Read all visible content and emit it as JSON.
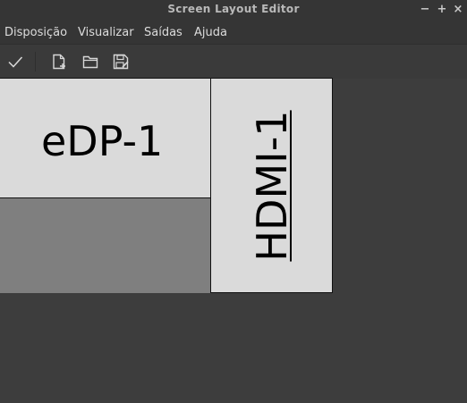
{
  "window": {
    "title": "Screen Layout Editor",
    "controls": {
      "minimize": "−",
      "maximize": "+",
      "close": "×"
    }
  },
  "menubar": {
    "items": [
      {
        "label": "Disposição"
      },
      {
        "label": "Visualizar"
      },
      {
        "label": "Saídas"
      },
      {
        "label": "Ajuda"
      }
    ]
  },
  "toolbar": {
    "buttons": [
      {
        "icon": "checkmark-icon"
      },
      {
        "icon": "new-file-icon"
      },
      {
        "icon": "folder-icon"
      },
      {
        "icon": "save-icon"
      }
    ]
  },
  "layout": {
    "monitors": [
      {
        "name": "eDP-1",
        "orientation": "normal",
        "selected": false
      },
      {
        "name": "HDMI-1",
        "orientation": "left",
        "selected": true
      }
    ]
  },
  "colors": {
    "background": "#3d3d3d",
    "monitor_fill": "#dadada",
    "screen_area": "#7f7f7f"
  }
}
